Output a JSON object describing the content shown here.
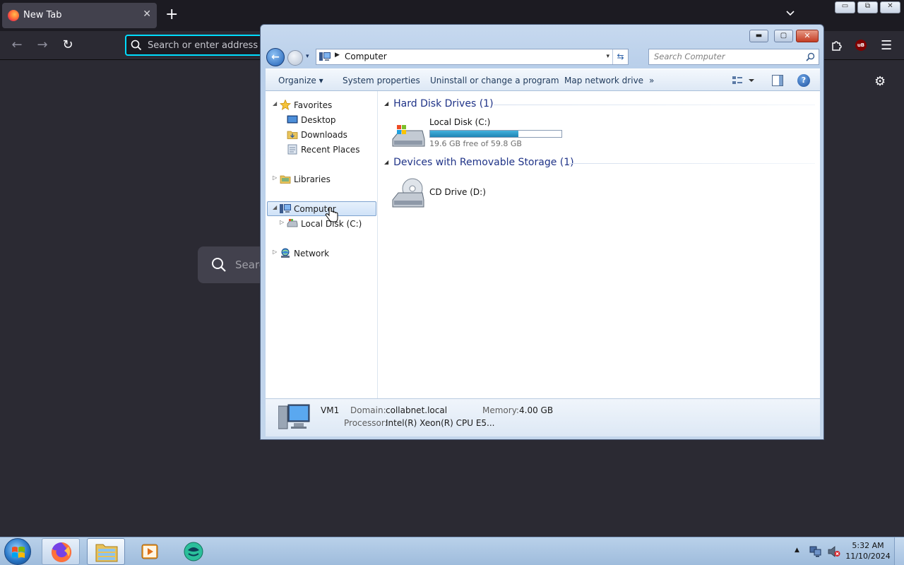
{
  "firefox": {
    "tab": {
      "title": "New Tab",
      "close": "✕"
    },
    "new_tab": "+",
    "nav": {
      "back": "←",
      "forward": "→",
      "reload": "↻",
      "menu": "☰"
    },
    "urlbar": {
      "placeholder": "Search or enter address"
    },
    "ublock_badge": "uB",
    "caption": {
      "minimize": "▭",
      "restore": "⧉",
      "close": "✕"
    },
    "content": {
      "settings": "⚙",
      "search_placeholder": "Search"
    }
  },
  "explorer": {
    "caption": {
      "minimize": "▬",
      "maximize": "▢",
      "close": "✕"
    },
    "nav": {
      "back": "←",
      "dropdown": "▾"
    },
    "address": {
      "separator": "▶",
      "location": "Computer",
      "dropdown": "▾",
      "refresh": "⇆"
    },
    "search": {
      "placeholder": "Search Computer"
    },
    "toolbar": {
      "organize": "Organize ▾",
      "system_properties": "System properties",
      "uninstall": "Uninstall or change a program",
      "map_network_drive": "Map network drive",
      "more": "»",
      "help": "?"
    },
    "nav_pane": {
      "favorites": "Favorites",
      "desktop": "Desktop",
      "downloads": "Downloads",
      "recent_places": "Recent Places",
      "libraries": "Libraries",
      "computer": "Computer",
      "local_disk": "Local Disk (C:)",
      "network": "Network",
      "expanded_marker": "◢",
      "collapsed_marker": "▷"
    },
    "groups": {
      "hard_disk": {
        "title": "Hard Disk Drives (1)",
        "marker": "◢"
      },
      "removable": {
        "title": "Devices with Removable Storage (1)",
        "marker": "◢"
      }
    },
    "drives": {
      "c": {
        "name": "Local Disk (C:)",
        "free_text": "19.6 GB free of 59.8 GB",
        "used_fraction": 0.672
      },
      "d": {
        "name": "CD Drive (D:)"
      }
    },
    "details": {
      "computer_name": "VM1",
      "domain_label": "Domain:",
      "domain": "collabnet.local",
      "memory_label": "Memory:",
      "memory": "4.00 GB",
      "processor_label": "Processor:",
      "processor": "Intel(R) Xeon(R) CPU E5..."
    }
  },
  "taskbar": {
    "tray_expand": "▲",
    "time": "5:32 AM",
    "date": "11/10/2024"
  },
  "colors": {
    "firefox_bg": "#1c1b22",
    "firefox_toolbar": "#2b2a33",
    "focus_ring": "#00ddff",
    "explorer_frame": "#c3d6ec",
    "group_header": "#1e3287",
    "capacity_fill": "#1f84b5",
    "taskbar": "#9fbcdc"
  }
}
